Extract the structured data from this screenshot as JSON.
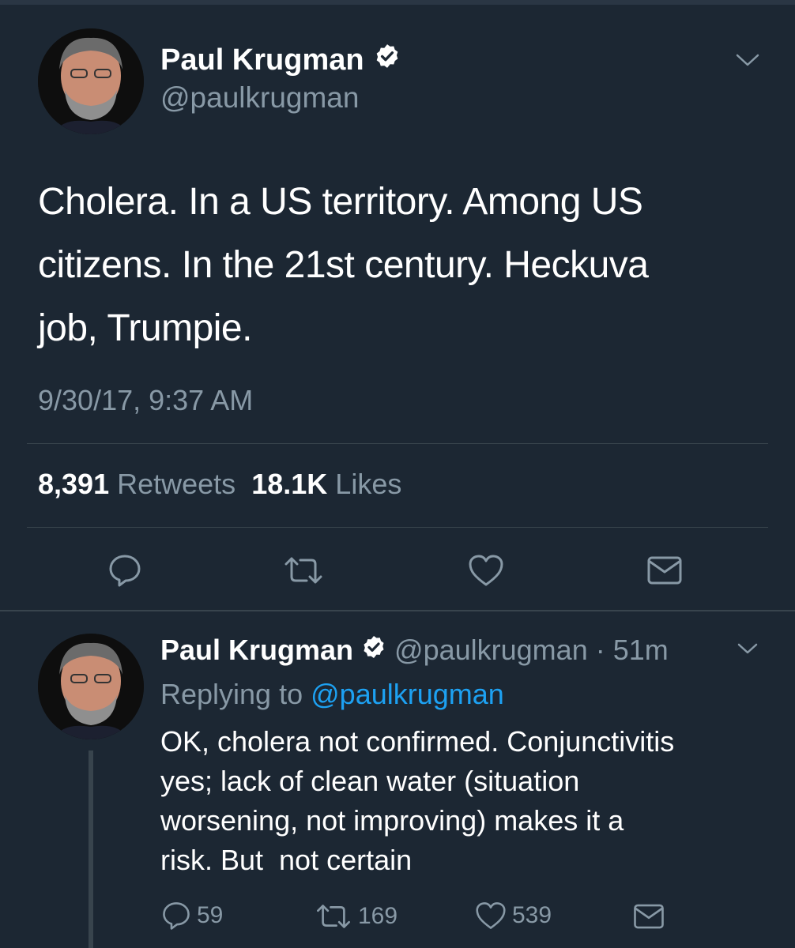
{
  "main_tweet": {
    "author_name": "Paul Krugman",
    "handle": "@paulkrugman",
    "text_lines": [
      "Cholera. In a US territory. Among US",
      "citizens. In the 21st century. Heckuva",
      "job, Trumpie."
    ],
    "timestamp": "9/30/17, 9:37 AM",
    "retweets_count": "8,391",
    "retweets_label": "Retweets",
    "likes_count": "18.1K",
    "likes_label": "Likes",
    "actions": [
      "reply-icon",
      "retweet-icon",
      "like-icon",
      "direct-message-icon"
    ]
  },
  "reply_tweet": {
    "author_name": "Paul Krugman",
    "meta": "@paulkrugman · 51m",
    "replying_prefix": "Replying to",
    "replying_handle": "@paulkrugman",
    "text_lines": [
      "OK, cholera not confirmed. Conjunctivitis",
      "yes; lack of clean water (situation",
      "worsening, not improving) makes it a",
      "risk. But  not certain"
    ],
    "reply_count": "59",
    "retweet_count": "169",
    "like_count": "539"
  },
  "colors": {
    "background": "#1c2733",
    "text": "#ffffff",
    "secondary_text": "#8899a6",
    "link": "#1da1f2",
    "divider": "#38444d"
  }
}
